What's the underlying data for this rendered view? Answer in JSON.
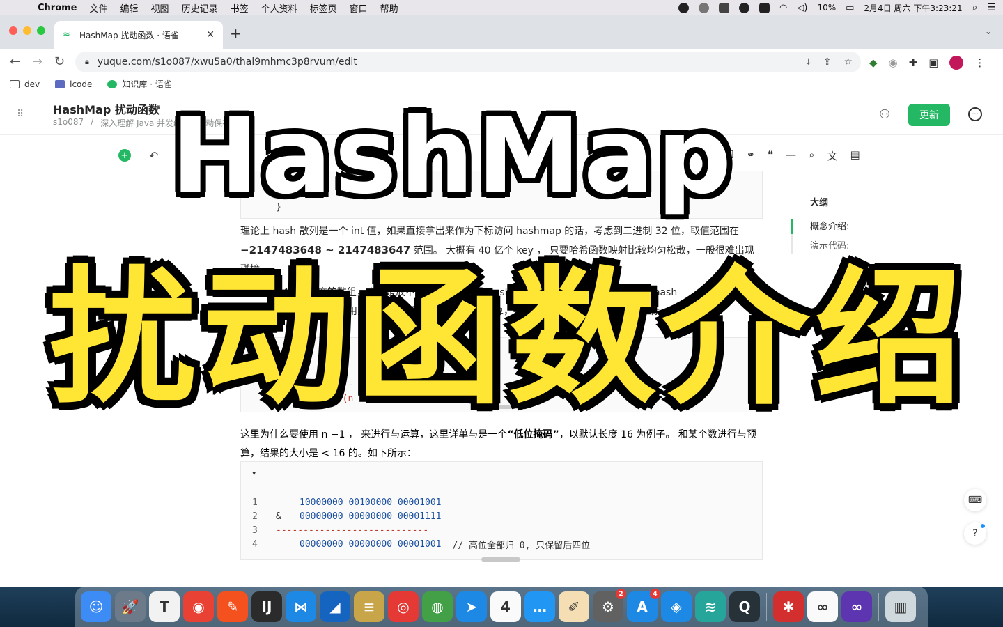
{
  "menubar": {
    "app_name": "Chrome",
    "menus": [
      "文件",
      "编辑",
      "视图",
      "历史记录",
      "书签",
      "个人资料",
      "标签页",
      "窗口",
      "帮助"
    ],
    "battery": "10%",
    "datetime": "2月4日 周六 下午3:23:21"
  },
  "browser": {
    "tab_title": "HashMap 扰动函数 · 语雀",
    "url": "yuque.com/s1o087/xwu5a0/thal9mhmc3p8rvum/edit",
    "bookmarks": [
      "dev",
      "lcode",
      "知识库 · 语雀"
    ]
  },
  "doc": {
    "title": "HashMap 扰动函数",
    "breadcrumb_user": "s1o087",
    "breadcrumb_book": "深入理解 Java 并发编程",
    "save_status": "自动保存中",
    "update_label": "更新",
    "paragraph1_a": "理论上 hash 散列是一个 int 值，如果直接拿出来作为下标访问 hashmap 的话，考虑到二进制 32 位，取值范围在",
    "paragraph1_range": "−2147483648 ~ 2147483647",
    "paragraph1_b": "范围。 大概有 40 亿个 key ， 只要哈希函数映射比较均匀松散，一般很难出现碰撞。",
    "paragraph2_l1": "但是一个 40 亿长度的数组，内存是放不下的。因为咱们 HashMap 默认长度是 16 ，所以这个 hash",
    "paragraph2_l2": "值是不能直接拿来用的。用之前还要先做对数组长度取模运算，得到的余数才能用来访问数组下标。",
    "code_mid_1": "(n - 1) & hash",
    "code_mid_2": "= (n",
    "paragraph3_a": "这里为什么要使用 n −1 ， 来进行与运算，这里详单与是一个",
    "paragraph3_bold": "“低位掩码”",
    "paragraph3_b": "，以默认长度 16 为例子。 和某个数进行与预算，结果的大小是 < 16 的。如下所示："
  },
  "code_block": {
    "lines": [
      {
        "num": "1",
        "op": "",
        "bin": "10000000 00100000 00001001",
        "comment": ""
      },
      {
        "num": "2",
        "op": "&",
        "bin": "00000000 00000000 00001111",
        "comment": ""
      },
      {
        "num": "3",
        "op": "",
        "bin": "----------------------------",
        "comment": ""
      },
      {
        "num": "4",
        "op": "",
        "bin": "00000000 00000000 00001001",
        "comment": "// 高位全部归 0, 只保留后四位"
      }
    ]
  },
  "outline": {
    "title": "大纲",
    "items": [
      "概念介绍:",
      "演示代码:"
    ]
  },
  "overlay": {
    "title_en": "HashMap",
    "title_cn": "扰动函数介绍"
  },
  "dock": {
    "apps": [
      {
        "name": "finder",
        "color": "#3d8bf5",
        "glyph": "☺"
      },
      {
        "name": "launchpad",
        "color": "#6c7a89",
        "glyph": "🚀"
      },
      {
        "name": "typora",
        "color": "#f2f2f2",
        "glyph": "T"
      },
      {
        "name": "chrome",
        "color": "#e94235",
        "glyph": "◉"
      },
      {
        "name": "draw",
        "color": "#f4511e",
        "glyph": "✎"
      },
      {
        "name": "intellij",
        "color": "#2b2b2b",
        "glyph": "IJ"
      },
      {
        "name": "vscode",
        "color": "#1e88e5",
        "glyph": "⋈"
      },
      {
        "name": "blue-app",
        "color": "#1565c0",
        "glyph": "◢"
      },
      {
        "name": "sequel",
        "color": "#c9a54a",
        "glyph": "≡"
      },
      {
        "name": "netease-music",
        "color": "#e53935",
        "glyph": "◎"
      },
      {
        "name": "wechat",
        "color": "#43a047",
        "glyph": "◍"
      },
      {
        "name": "feishu",
        "color": "#1e88e5",
        "glyph": "➤"
      },
      {
        "name": "calendar",
        "color": "#fafafa",
        "glyph": "4"
      },
      {
        "name": "messages",
        "color": "#2196f3",
        "glyph": "…"
      },
      {
        "name": "notes",
        "color": "#f5deb3",
        "glyph": "✐"
      },
      {
        "name": "system-preferences",
        "color": "#616161",
        "glyph": "⚙",
        "badge": "2"
      },
      {
        "name": "app-store",
        "color": "#1e88e5",
        "glyph": "A",
        "badge": "4"
      },
      {
        "name": "safari",
        "color": "#1e88e5",
        "glyph": "◈"
      },
      {
        "name": "xmind",
        "color": "#26a69a",
        "glyph": "≋"
      },
      {
        "name": "quicktime",
        "color": "#263238",
        "glyph": "Q"
      },
      {
        "name": "network-app",
        "color": "#d32f2f",
        "glyph": "✱"
      },
      {
        "name": "baidu-netdisk",
        "color": "#fafafa",
        "glyph": "∞"
      },
      {
        "name": "link-app",
        "color": "#5e35b1",
        "glyph": "∞"
      },
      {
        "name": "trash",
        "color": "#cfd8dc",
        "glyph": "▥"
      }
    ]
  }
}
